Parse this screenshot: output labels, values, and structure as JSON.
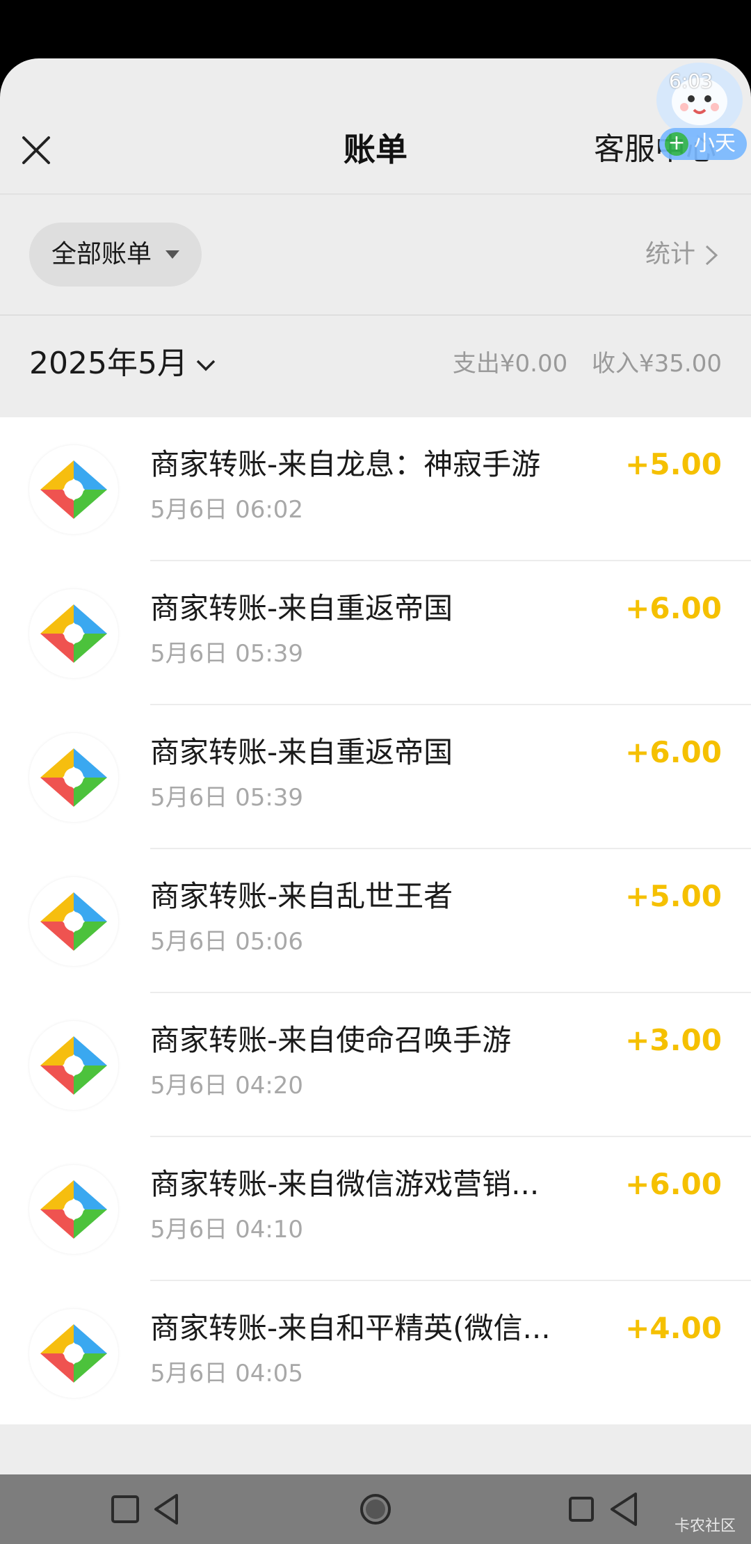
{
  "header": {
    "title": "账单",
    "service_label": "客服中心"
  },
  "assistant": {
    "time": "6:03",
    "label": "小天"
  },
  "filter": {
    "label": "全部账单",
    "stats_label": "统计"
  },
  "month": {
    "label": "2025年5月",
    "expense": "支出¥0.00",
    "income": "收入¥35.00"
  },
  "transactions": [
    {
      "name": "商家转账-来自龙息：神寂手游",
      "time": "5月6日 06:02",
      "amount": "+5.00"
    },
    {
      "name": "商家转账-来自重返帝国",
      "time": "5月6日 05:39",
      "amount": "+6.00"
    },
    {
      "name": "商家转账-来自重返帝国",
      "time": "5月6日 05:39",
      "amount": "+6.00"
    },
    {
      "name": "商家转账-来自乱世王者",
      "time": "5月6日 05:06",
      "amount": "+5.00"
    },
    {
      "name": "商家转账-来自使命召唤手游",
      "time": "5月6日 04:20",
      "amount": "+3.00"
    },
    {
      "name": "商家转账-来自微信游戏营销...",
      "time": "5月6日 04:10",
      "amount": "+6.00"
    },
    {
      "name": "商家转账-来自和平精英(微信...",
      "time": "5月6日 04:05",
      "amount": "+4.00"
    }
  ],
  "watermark": "卡农社区",
  "colors": {
    "amount": "#f5c000",
    "background": "#ededed",
    "logo_yellow": "#f6be0f",
    "logo_blue": "#3aa8f0",
    "logo_red": "#ef5350",
    "logo_green": "#4cc23c"
  }
}
